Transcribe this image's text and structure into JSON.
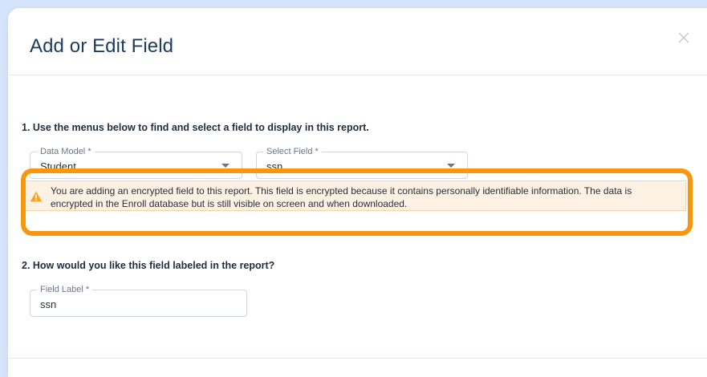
{
  "modal": {
    "title": "Add or Edit Field"
  },
  "step1": {
    "text": "1. Use the menus below to find and select a field to display in this report.",
    "data_model": {
      "label": "Data Model *",
      "value": "Student"
    },
    "select_field": {
      "label": "Select Field *",
      "value": "ssn"
    }
  },
  "warning": {
    "icon": "warning-triangle-icon",
    "color": "#f5a623",
    "text": "You are adding an encrypted field to this report. This field is encrypted because it contains personally identifiable information. The data is encrypted in the Enroll database but is still visible on screen and when downloaded."
  },
  "step2": {
    "text": "2. How would you like this field labeled in the report?",
    "field_label": {
      "label": "Field Label *",
      "value": "ssn"
    }
  },
  "colors": {
    "background": "#d6e4fb",
    "title": "#1e3a5f",
    "highlight": "#f7970e",
    "warning_bg": "#fdf1e3"
  }
}
